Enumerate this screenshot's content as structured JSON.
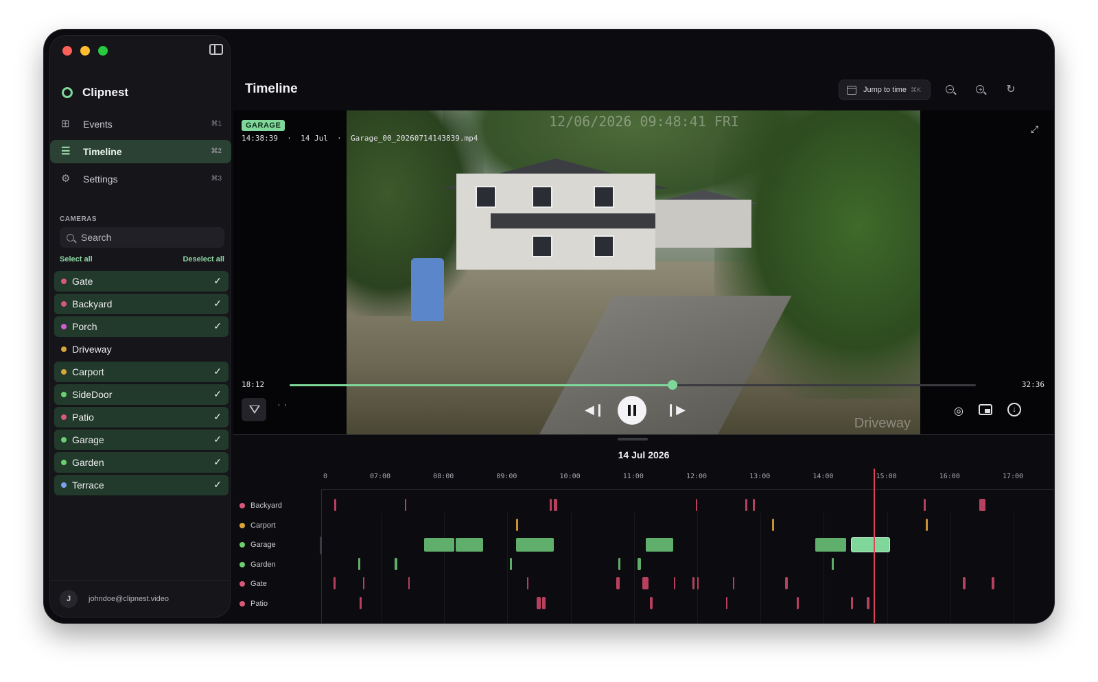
{
  "app": {
    "name": "Clipnest",
    "page_title": "Timeline"
  },
  "nav": [
    {
      "label": "Events",
      "shortcut": "⌘1",
      "icon": "grid-icon",
      "active": false
    },
    {
      "label": "Timeline",
      "shortcut": "⌘2",
      "icon": "timeline-icon",
      "active": true
    },
    {
      "label": "Settings",
      "shortcut": "⌘3",
      "icon": "gear-icon",
      "active": false
    }
  ],
  "cameras": {
    "title": "CAMERAS",
    "search_placeholder": "Search",
    "select_all": "Select all",
    "deselect_all": "Deselect all",
    "items": [
      {
        "name": "Gate",
        "color": "#d9587a",
        "selected": true
      },
      {
        "name": "Backyard",
        "color": "#d9587a",
        "selected": true
      },
      {
        "name": "Porch",
        "color": "#d35bd3",
        "selected": true
      },
      {
        "name": "Driveway",
        "color": "#d9a43a",
        "selected": false
      },
      {
        "name": "Carport",
        "color": "#d9a43a",
        "selected": true
      },
      {
        "name": "SideDoor",
        "color": "#6ccf6f",
        "selected": true
      },
      {
        "name": "Patio",
        "color": "#d9587a",
        "selected": true
      },
      {
        "name": "Garage",
        "color": "#6ccf6f",
        "selected": true
      },
      {
        "name": "Garden",
        "color": "#6ccf6f",
        "selected": true
      },
      {
        "name": "Terrace",
        "color": "#7aa2e8",
        "selected": true
      }
    ]
  },
  "user": {
    "initial": "J",
    "email": "johndoe@clipnest.video"
  },
  "header": {
    "jump_label": "Jump to time",
    "jump_shortcut": "⌘K"
  },
  "player": {
    "camera_badge": "GARAGE",
    "clip_time": "14:38:39",
    "clip_date": "14 Jul",
    "clip_file": "Garage_00_20260714143839.mp4",
    "osd_timestamp": "12/06/2026 09:48:41 FRI",
    "osd_camera": "Driveway",
    "elapsed": "18:12",
    "duration": "32:36",
    "progress": 0.558
  },
  "timeline": {
    "date": "14 Jul 2026",
    "ticks": [
      "07:00",
      "08:00",
      "09:00",
      "10:00",
      "11:00",
      "12:00",
      "13:00",
      "14:00",
      "15:00",
      "16:00",
      "17:00"
    ],
    "playhead": "14:48",
    "lanes": [
      {
        "name": "Backyard",
        "color": "#d9587a"
      },
      {
        "name": "Carport",
        "color": "#d9a43a"
      },
      {
        "name": "Garage",
        "color": "#6ccf6f"
      },
      {
        "name": "Garden",
        "color": "#6ccf6f"
      },
      {
        "name": "Gate",
        "color": "#d9587a"
      },
      {
        "name": "Patio",
        "color": "#d9587a"
      }
    ]
  },
  "colors": {
    "accent": "#7fd89a",
    "event_red": "#b8405f",
    "event_green": "#5fae6b",
    "playhead": "#e0415e"
  }
}
